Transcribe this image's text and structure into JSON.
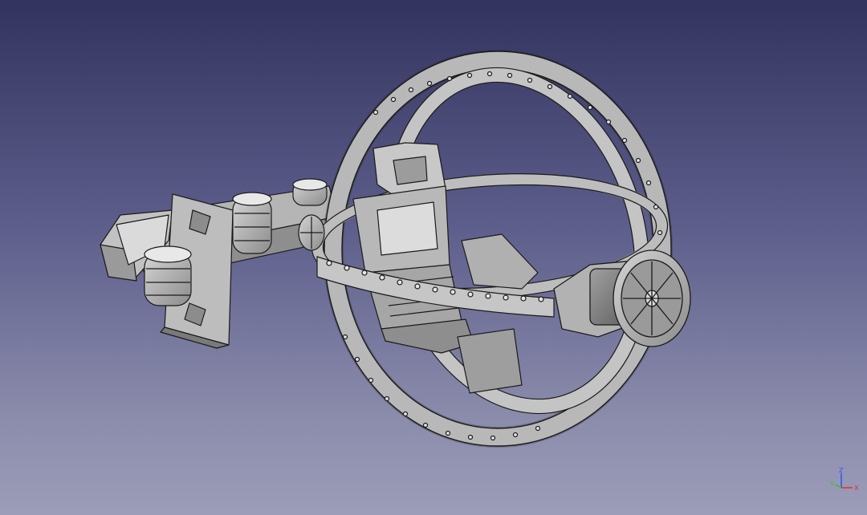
{
  "viewport": {
    "background_top": "#33335f",
    "background_bottom": "#9c9db8"
  },
  "model": {
    "description_icon": "gyroscope-ring-model",
    "fill_color": "#a8a8a8",
    "edge_color": "#1a1a1a",
    "highlight_color": "#d9d9d9",
    "shadow_color": "#6e6e6e"
  },
  "axis_indicator": {
    "x_label": "X",
    "y_label": "Y",
    "z_label": "Z",
    "x_color": "#e03030",
    "y_color": "#30c030",
    "z_color": "#3050ff"
  }
}
